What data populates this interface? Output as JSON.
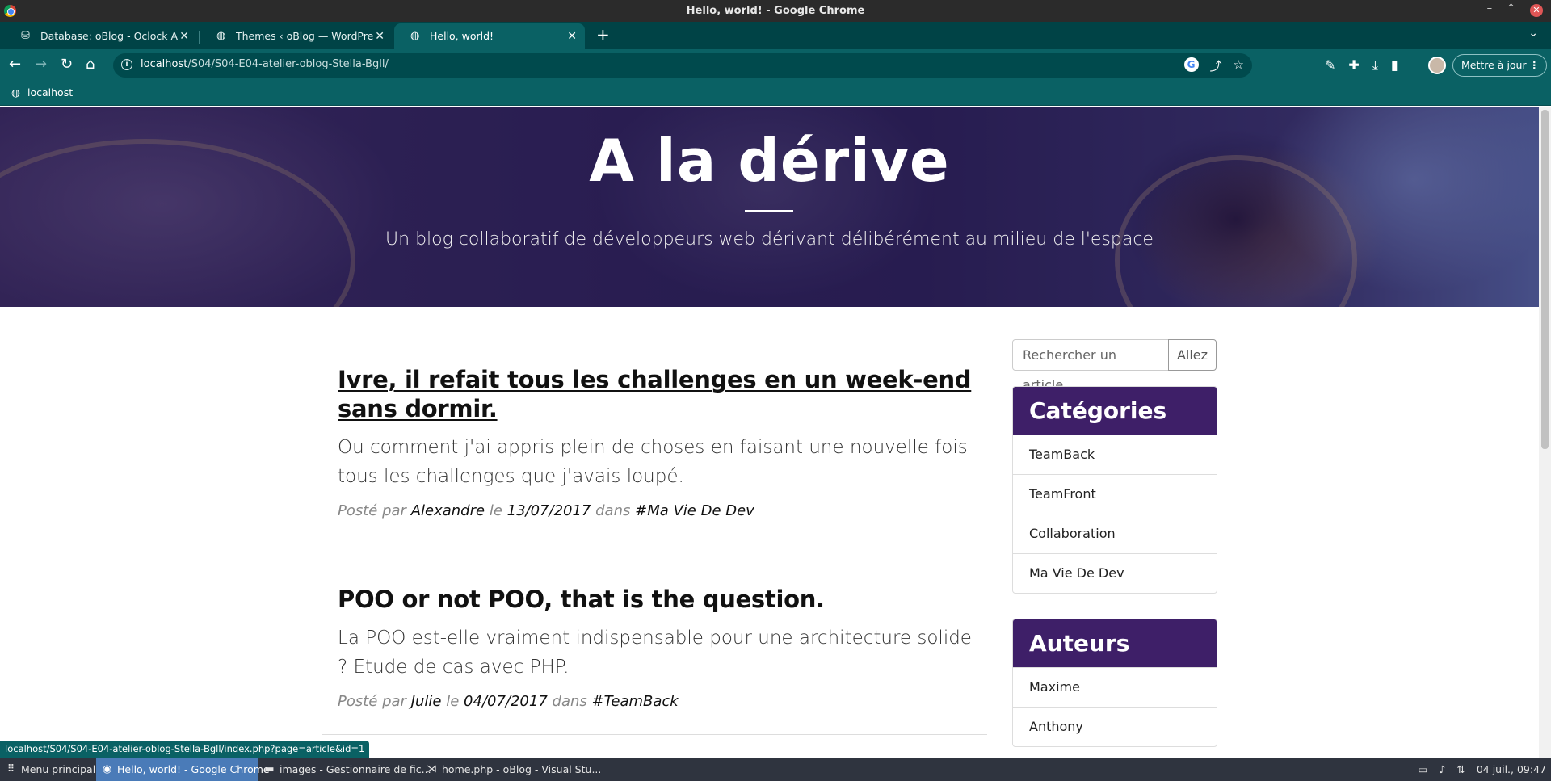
{
  "window": {
    "title": "Hello, world! - Google Chrome"
  },
  "tabs": [
    {
      "label": "Database: oBlog - Oclock Admi",
      "icon": "database-icon",
      "active": false
    },
    {
      "label": "Themes ‹ oBlog — WordPress",
      "icon": "globe-icon",
      "active": false
    },
    {
      "label": "Hello, world!",
      "icon": "globe-icon",
      "active": true
    }
  ],
  "toolbar": {
    "url_host": "localhost",
    "url_path": "/S04/S04-E04-atelier-oblog-Stella-Bgll/",
    "update_label": "Mettre à jour"
  },
  "bookmarks": [
    {
      "label": "localhost",
      "icon": "globe-icon"
    }
  ],
  "hero": {
    "title": "A la dérive",
    "subtitle": "Un blog collaboratif de développeurs web dérivant délibérément au milieu de l'espace"
  },
  "articles": [
    {
      "title": "Ivre, il refait tous les challenges en un week-end sans dormir.",
      "excerpt": "Ou comment j'ai appris plein de choses en faisant une nouvelle fois tous les challenges que j'avais loupé.",
      "posted_by_label": "Posté par",
      "author": "Alexandre",
      "date_label": "le",
      "date": "13/07/2017",
      "in_label": "dans",
      "category": "#Ma Vie De Dev"
    },
    {
      "title": "POO or not POO, that is the question.",
      "excerpt": "La POO est-elle vraiment indispensable pour une architecture solide ? Etude de cas avec PHP.",
      "posted_by_label": "Posté par",
      "author": "Julie",
      "date_label": "le",
      "date": "04/07/2017",
      "in_label": "dans",
      "category": "#TeamBack"
    }
  ],
  "sidebar": {
    "search_placeholder": "Rechercher un article...",
    "search_button": "Allez",
    "categories_title": "Catégories",
    "categories": [
      "TeamBack",
      "TeamFront",
      "Collaboration",
      "Ma Vie De Dev"
    ],
    "authors_title": "Auteurs",
    "authors": [
      "Maxime",
      "Anthony"
    ]
  },
  "status_bar": {
    "url": "localhost/S04/S04-E04-atelier-oblog-Stella-Bgll/index.php?page=article&id=1"
  },
  "taskbar": {
    "items": [
      {
        "label": "Menu principal",
        "icon": "app-grid-icon"
      },
      {
        "label": "Hello, world! - Google Chrome",
        "icon": "chrome-icon",
        "active": true
      },
      {
        "label": "images - Gestionnaire de fic...",
        "icon": "folder-icon"
      },
      {
        "label": "home.php - oBlog - Visual Stu...",
        "icon": "vscode-icon"
      }
    ],
    "clock": "04 juil., 09:47"
  },
  "colors": {
    "tab_strip": "#004346",
    "toolbar": "#0a6164",
    "widget_header": "#3e1f68",
    "taskbar": "#2f343f",
    "taskbar_active": "#4a7bb8"
  }
}
